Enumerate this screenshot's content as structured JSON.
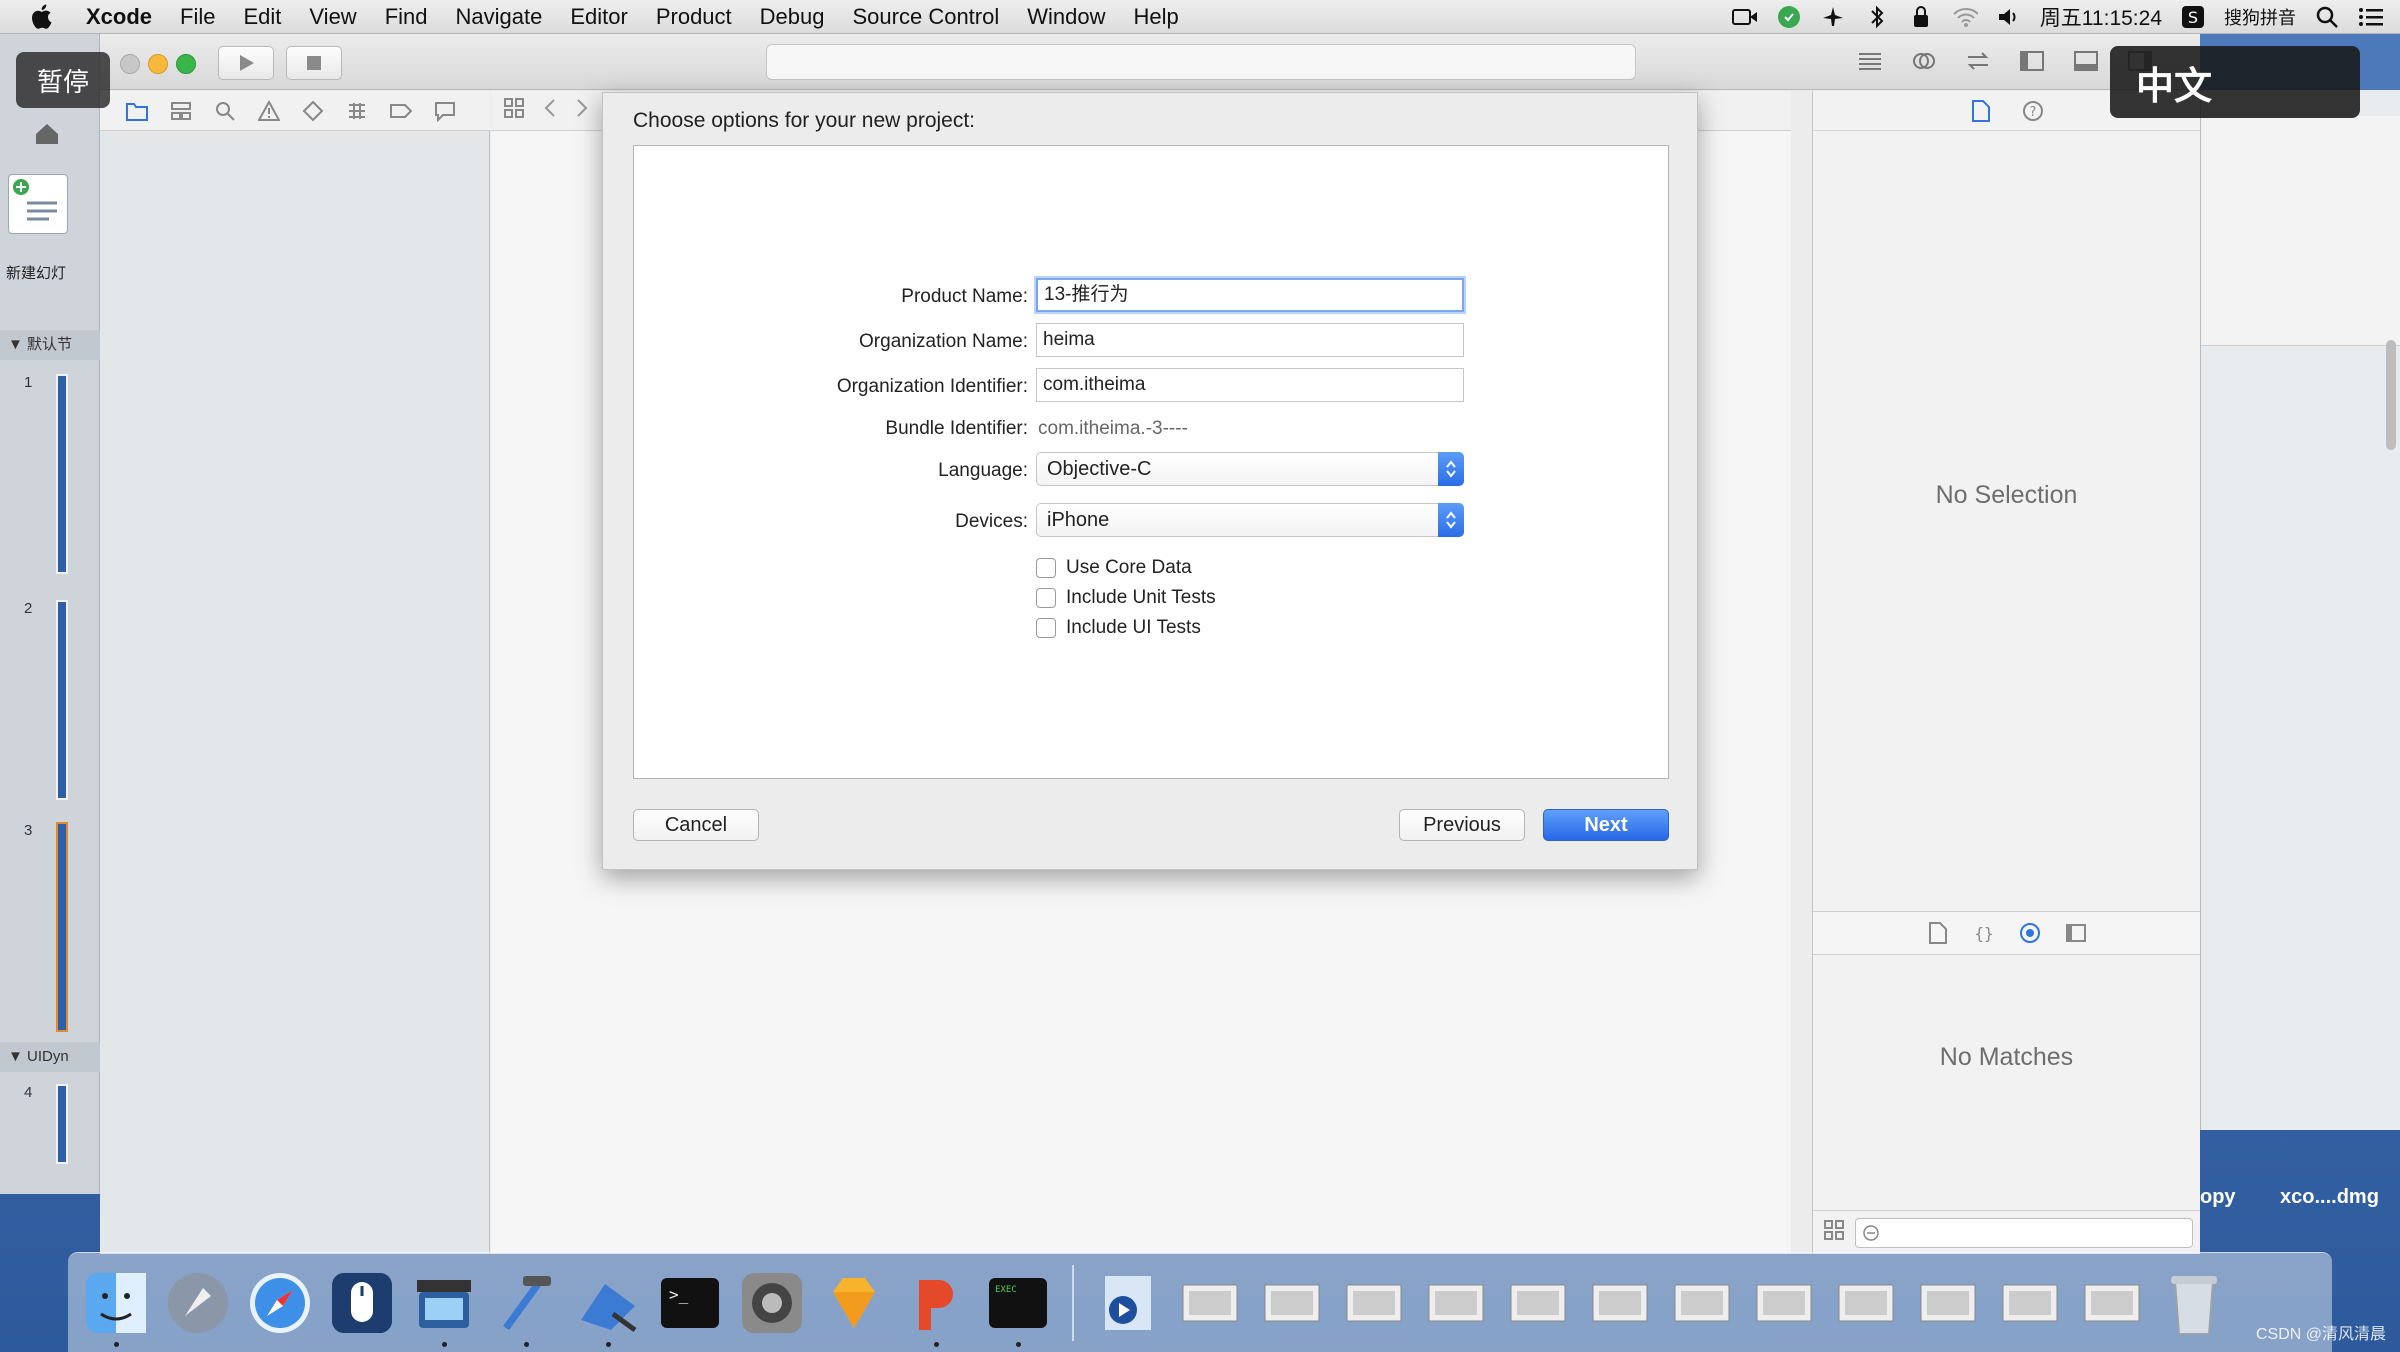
{
  "menubar": {
    "app": "Xcode",
    "items": [
      "File",
      "Edit",
      "View",
      "Find",
      "Navigate",
      "Editor",
      "Product",
      "Debug",
      "Source Control",
      "Window",
      "Help"
    ],
    "clock": "周五11:15:24",
    "ime": "搜狗拼音"
  },
  "overlay": {
    "pause": "暂停",
    "language": "中文"
  },
  "ppt": {
    "new_slide_label": "新建幻灯",
    "section1": "▼ 默认节",
    "section2": "▼ UIDyn",
    "slide_numbers": [
      "1",
      "2",
      "3",
      "4"
    ]
  },
  "dialog": {
    "title": "Choose options for your new project:",
    "fields": {
      "product_name_label": "Product Name:",
      "product_name_value": "13-推行为",
      "org_name_label": "Organization Name:",
      "org_name_value": "heima",
      "org_id_label": "Organization Identifier:",
      "org_id_value": "com.itheima",
      "bundle_id_label": "Bundle Identifier:",
      "bundle_id_value": "com.itheima.-3----",
      "language_label": "Language:",
      "language_value": "Objective-C",
      "devices_label": "Devices:",
      "devices_value": "iPhone"
    },
    "checkboxes": {
      "core_data": "Use Core Data",
      "unit_tests": "Include Unit Tests",
      "ui_tests": "Include UI Tests"
    },
    "buttons": {
      "cancel": "Cancel",
      "previous": "Previous",
      "next": "Next"
    }
  },
  "inspector": {
    "no_selection": "No Selection",
    "no_matches": "No Matches"
  },
  "desktop": {
    "label1": "opy",
    "label2": "xco....dmg"
  },
  "watermark": "CSDN @清风清晨",
  "colors": {
    "accent": "#2a6ee8",
    "desktop": "#3f6fb3"
  }
}
